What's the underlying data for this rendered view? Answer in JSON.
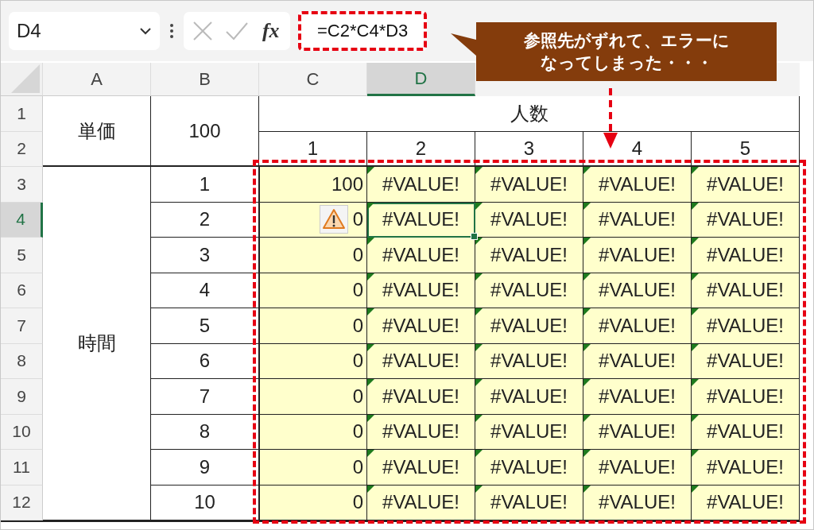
{
  "name_box": {
    "value": "D4"
  },
  "function_button": {
    "label": "fx"
  },
  "formula": {
    "value": "=C2*C4*D3"
  },
  "callout": {
    "lines": [
      "参照先がずれて、エラーに",
      "なってしまった・・・"
    ]
  },
  "columns": [
    {
      "label": "A",
      "selected": false
    },
    {
      "label": "B",
      "selected": false
    },
    {
      "label": "C",
      "selected": false
    },
    {
      "label": "D",
      "selected": true
    }
  ],
  "row_headers": [
    {
      "label": "1",
      "selected": false
    },
    {
      "label": "2",
      "selected": false
    },
    {
      "label": "3",
      "selected": false
    },
    {
      "label": "4",
      "selected": true
    },
    {
      "label": "5",
      "selected": false
    },
    {
      "label": "6",
      "selected": false
    },
    {
      "label": "7",
      "selected": false
    },
    {
      "label": "8",
      "selected": false
    },
    {
      "label": "9",
      "selected": false
    },
    {
      "label": "10",
      "selected": false
    },
    {
      "label": "11",
      "selected": false
    },
    {
      "label": "12",
      "selected": false
    }
  ],
  "price": {
    "label": "単価",
    "value": "100"
  },
  "people": {
    "label": "人数",
    "counts": [
      "1",
      "2",
      "3",
      "4",
      "5"
    ]
  },
  "time": {
    "label": "時間",
    "rows": [
      {
        "hours": "1",
        "cells": [
          {
            "value": "100",
            "error": false,
            "warning": false,
            "selected": false
          },
          {
            "value": "#VALUE!",
            "error": true,
            "warning": false,
            "selected": false
          },
          {
            "value": "#VALUE!",
            "error": true,
            "warning": false,
            "selected": false
          },
          {
            "value": "#VALUE!",
            "error": true,
            "warning": false,
            "selected": false
          },
          {
            "value": "#VALUE!",
            "error": true,
            "warning": false,
            "selected": false
          }
        ]
      },
      {
        "hours": "2",
        "cells": [
          {
            "value": "0",
            "error": false,
            "warning": true,
            "selected": false
          },
          {
            "value": "#VALUE!",
            "error": true,
            "warning": false,
            "selected": true
          },
          {
            "value": "#VALUE!",
            "error": true,
            "warning": false,
            "selected": false
          },
          {
            "value": "#VALUE!",
            "error": true,
            "warning": false,
            "selected": false
          },
          {
            "value": "#VALUE!",
            "error": true,
            "warning": false,
            "selected": false
          }
        ]
      },
      {
        "hours": "3",
        "cells": [
          {
            "value": "0",
            "error": false,
            "warning": false,
            "selected": false
          },
          {
            "value": "#VALUE!",
            "error": true,
            "warning": false,
            "selected": false
          },
          {
            "value": "#VALUE!",
            "error": true,
            "warning": false,
            "selected": false
          },
          {
            "value": "#VALUE!",
            "error": true,
            "warning": false,
            "selected": false
          },
          {
            "value": "#VALUE!",
            "error": true,
            "warning": false,
            "selected": false
          }
        ]
      },
      {
        "hours": "4",
        "cells": [
          {
            "value": "0",
            "error": false,
            "warning": false,
            "selected": false
          },
          {
            "value": "#VALUE!",
            "error": true,
            "warning": false,
            "selected": false
          },
          {
            "value": "#VALUE!",
            "error": true,
            "warning": false,
            "selected": false
          },
          {
            "value": "#VALUE!",
            "error": true,
            "warning": false,
            "selected": false
          },
          {
            "value": "#VALUE!",
            "error": true,
            "warning": false,
            "selected": false
          }
        ]
      },
      {
        "hours": "5",
        "cells": [
          {
            "value": "0",
            "error": false,
            "warning": false,
            "selected": false
          },
          {
            "value": "#VALUE!",
            "error": true,
            "warning": false,
            "selected": false
          },
          {
            "value": "#VALUE!",
            "error": true,
            "warning": false,
            "selected": false
          },
          {
            "value": "#VALUE!",
            "error": true,
            "warning": false,
            "selected": false
          },
          {
            "value": "#VALUE!",
            "error": true,
            "warning": false,
            "selected": false
          }
        ]
      },
      {
        "hours": "6",
        "cells": [
          {
            "value": "0",
            "error": false,
            "warning": false,
            "selected": false
          },
          {
            "value": "#VALUE!",
            "error": true,
            "warning": false,
            "selected": false
          },
          {
            "value": "#VALUE!",
            "error": true,
            "warning": false,
            "selected": false
          },
          {
            "value": "#VALUE!",
            "error": true,
            "warning": false,
            "selected": false
          },
          {
            "value": "#VALUE!",
            "error": true,
            "warning": false,
            "selected": false
          }
        ]
      },
      {
        "hours": "7",
        "cells": [
          {
            "value": "0",
            "error": false,
            "warning": false,
            "selected": false
          },
          {
            "value": "#VALUE!",
            "error": true,
            "warning": false,
            "selected": false
          },
          {
            "value": "#VALUE!",
            "error": true,
            "warning": false,
            "selected": false
          },
          {
            "value": "#VALUE!",
            "error": true,
            "warning": false,
            "selected": false
          },
          {
            "value": "#VALUE!",
            "error": true,
            "warning": false,
            "selected": false
          }
        ]
      },
      {
        "hours": "8",
        "cells": [
          {
            "value": "0",
            "error": false,
            "warning": false,
            "selected": false
          },
          {
            "value": "#VALUE!",
            "error": true,
            "warning": false,
            "selected": false
          },
          {
            "value": "#VALUE!",
            "error": true,
            "warning": false,
            "selected": false
          },
          {
            "value": "#VALUE!",
            "error": true,
            "warning": false,
            "selected": false
          },
          {
            "value": "#VALUE!",
            "error": true,
            "warning": false,
            "selected": false
          }
        ]
      },
      {
        "hours": "9",
        "cells": [
          {
            "value": "0",
            "error": false,
            "warning": false,
            "selected": false
          },
          {
            "value": "#VALUE!",
            "error": true,
            "warning": false,
            "selected": false
          },
          {
            "value": "#VALUE!",
            "error": true,
            "warning": false,
            "selected": false
          },
          {
            "value": "#VALUE!",
            "error": true,
            "warning": false,
            "selected": false
          },
          {
            "value": "#VALUE!",
            "error": true,
            "warning": false,
            "selected": false
          }
        ]
      },
      {
        "hours": "10",
        "cells": [
          {
            "value": "0",
            "error": false,
            "warning": false,
            "selected": false
          },
          {
            "value": "#VALUE!",
            "error": true,
            "warning": false,
            "selected": false
          },
          {
            "value": "#VALUE!",
            "error": true,
            "warning": false,
            "selected": false
          },
          {
            "value": "#VALUE!",
            "error": true,
            "warning": false,
            "selected": false
          },
          {
            "value": "#VALUE!",
            "error": true,
            "warning": false,
            "selected": false
          }
        ]
      }
    ]
  }
}
